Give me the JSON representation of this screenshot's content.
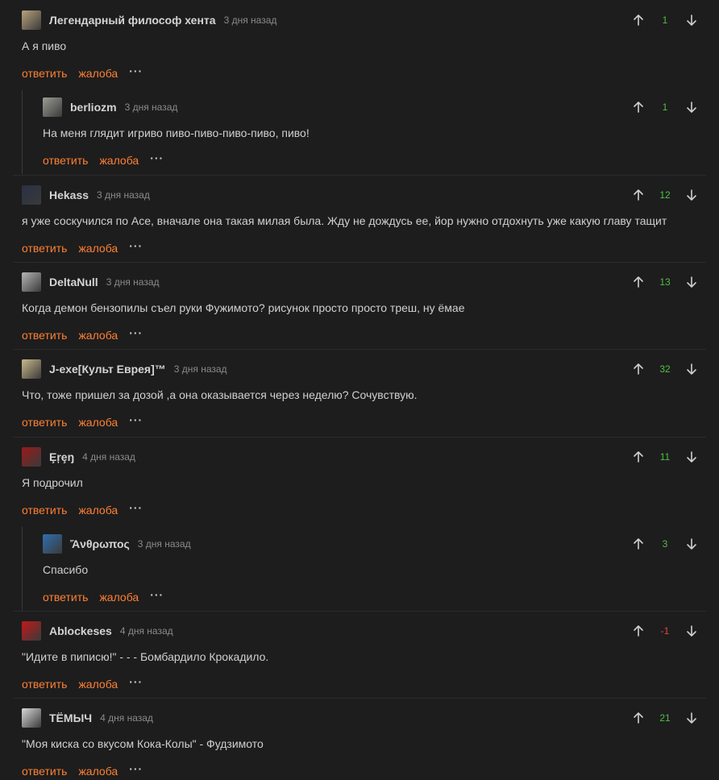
{
  "labels": {
    "reply": "ответить",
    "report": "жалоба",
    "more": "···"
  },
  "colors": {
    "background": "#1d1d1d",
    "link": "#ff8033",
    "score_positive": "#4fbf43",
    "score_negative": "#e0473b"
  },
  "comments": [
    {
      "user": "Легендарный философ хента",
      "time": "3 дня назад",
      "score": "1",
      "text": "А я пиво",
      "reply": false,
      "avatar": "#b8a27a"
    },
    {
      "user": "berliozm",
      "time": "3 дня назад",
      "score": "1",
      "text": "На меня глядит игриво пиво-пиво-пиво-пиво, пиво!",
      "reply": true,
      "avatar": "#9c9c94"
    },
    {
      "user": "Hekass",
      "time": "3 дня назад",
      "score": "12",
      "text": "я уже соскучился по Асе, вначале она такая милая была. Жду не дождусь ее, йор нужно отдохнуть уже какую главу тащит",
      "reply": false,
      "avatar": "#2a3044"
    },
    {
      "user": "DeltaNull",
      "time": "3 дня назад",
      "score": "13",
      "text": "Когда демон бензопилы съел руки Фужимото? рисунок просто просто треш, ну ёмае",
      "reply": false,
      "avatar": "#b5b5b5"
    },
    {
      "user": "J-exe[Культ Еврея]™",
      "time": "3 дня назад",
      "score": "32",
      "text": "Что, тоже пришел за дозой ,а она оказывается через неделю? Сочувствую.",
      "reply": false,
      "avatar": "#c9b88a"
    },
    {
      "user": "Ȩŗȩŋ",
      "time": "4 дня назад",
      "score": "11",
      "text": "Я подрочил",
      "reply": false,
      "avatar": "#9a1a1a"
    },
    {
      "user": "Ἄνθρωπος",
      "time": "3 дня назад",
      "score": "3",
      "text": "Спасибо",
      "reply": true,
      "avatar": "#2f6fb0"
    },
    {
      "user": "Ablockeses",
      "time": "4 дня назад",
      "score": "-1",
      "text": "\"Идите в пиписю!\" - - - Бомбардило Крокадило.",
      "reply": false,
      "avatar": "#c21818"
    },
    {
      "user": "ТЁМЫЧ",
      "time": "4 дня назад",
      "score": "21",
      "text": "\"Моя киска со вкусом Кока-Колы\" - Фудзимото",
      "reply": false,
      "avatar": "#d8d8d8"
    }
  ]
}
